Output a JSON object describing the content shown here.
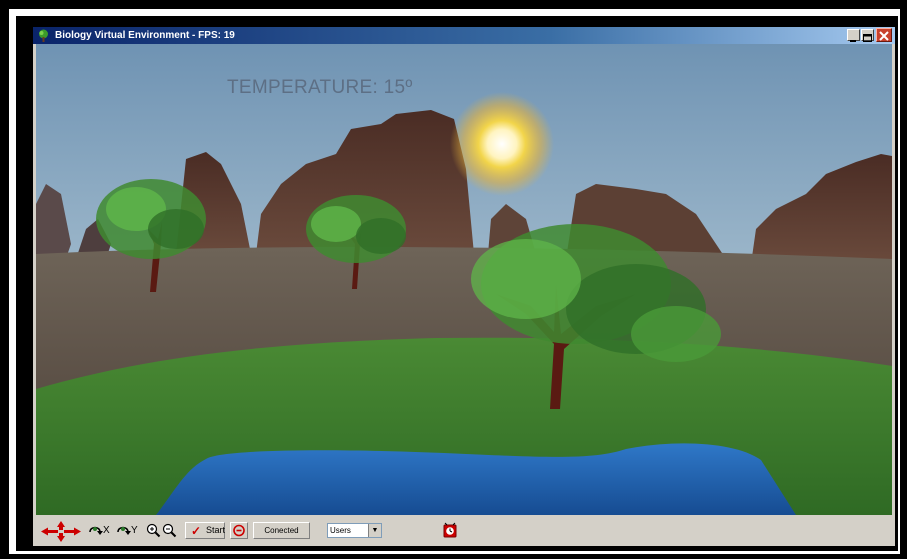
{
  "window": {
    "title": "Biology Virtual Environment - FPS: 19",
    "controls": [
      "minimize",
      "maximize",
      "close"
    ]
  },
  "scene": {
    "temperature_label": "TEMPERATURE: 15º",
    "elements": [
      "sky",
      "sun",
      "rock-mountains",
      "dirt-plain",
      "grass-hill",
      "pond",
      "tree-left",
      "tree-middle",
      "tree-right"
    ]
  },
  "toolbar": {
    "icons": [
      "move-arrows-icon",
      "rotate-x-icon",
      "rotate-y-icon",
      "zoom-in-icon",
      "zoom-out-icon",
      "stop-icon",
      "alarm-clock-icon"
    ],
    "rotate_x_label": "X",
    "rotate_y_label": "Y",
    "start_label": "Start",
    "connected_label": "Conected",
    "users_select_value": "Users"
  },
  "colors": {
    "sky": "#8fb0c8",
    "grass": "#3f7a2c",
    "water": "#1f5fa8",
    "temperature_text": "#5d6f85",
    "toolbar": "#d4d0c8"
  }
}
